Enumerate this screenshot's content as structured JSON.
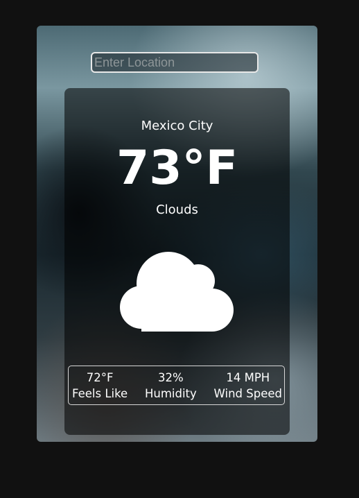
{
  "search": {
    "placeholder": "Enter Location",
    "value": ""
  },
  "weather": {
    "city": "Mexico City",
    "temperature": "73°F",
    "condition": "Clouds",
    "icon": "cloud-icon"
  },
  "stats": [
    {
      "value": "72°F",
      "label": "Feels Like"
    },
    {
      "value": "32%",
      "label": "Humidity"
    },
    {
      "value": "14 MPH",
      "label": "Wind Speed"
    }
  ],
  "colors": {
    "page_background": "#111111",
    "text": "#ffffff",
    "input_border": "#e8e8e8",
    "placeholder": "#8e9698"
  }
}
